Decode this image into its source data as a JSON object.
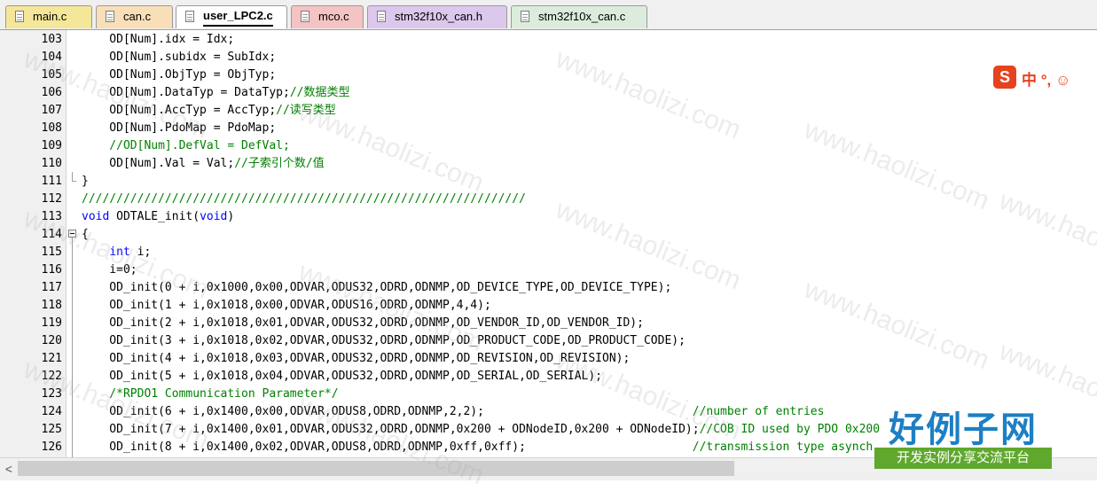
{
  "tabs": [
    {
      "label": "main.c",
      "color": "#f4e79a",
      "active": false
    },
    {
      "label": "can.c",
      "color": "#f8dfb8",
      "active": false
    },
    {
      "label": "user_LPC2.c",
      "color": "#ffffff",
      "active": true
    },
    {
      "label": "mco.c",
      "color": "#f4c3c3",
      "active": false
    },
    {
      "label": "stm32f10x_can.h",
      "color": "#dcc8ec",
      "active": false
    },
    {
      "label": "stm32f10x_can.c",
      "color": "#dcecdc",
      "active": false
    }
  ],
  "editor": {
    "line_numbers": [
      "103",
      "104",
      "105",
      "106",
      "107",
      "108",
      "109",
      "110",
      "111",
      "112",
      "113",
      "114",
      "115",
      "116",
      "117",
      "118",
      "119",
      "120",
      "121",
      "122",
      "123",
      "124",
      "125",
      "126"
    ],
    "lines": [
      [
        {
          "t": "    OD[Num].idx = Idx;",
          "c": "n"
        }
      ],
      [
        {
          "t": "    OD[Num].subidx = SubIdx;",
          "c": "n"
        }
      ],
      [
        {
          "t": "    OD[Num].ObjTyp = ObjTyp;",
          "c": "n"
        }
      ],
      [
        {
          "t": "    OD[Num].DataTyp = DataTyp;",
          "c": "n"
        },
        {
          "t": "//数据类型",
          "c": "c"
        }
      ],
      [
        {
          "t": "    OD[Num].AccTyp = AccTyp;",
          "c": "n"
        },
        {
          "t": "//读写类型",
          "c": "c"
        }
      ],
      [
        {
          "t": "    OD[Num].PdoMap = PdoMap;",
          "c": "n"
        }
      ],
      [
        {
          "t": "    //OD[Num].DefVal = DefVal;",
          "c": "c"
        }
      ],
      [
        {
          "t": "    OD[Num].Val = Val;",
          "c": "n"
        },
        {
          "t": "//子索引个数/值",
          "c": "c"
        }
      ],
      [
        {
          "t": "}",
          "c": "n"
        }
      ],
      [
        {
          "t": "////////////////////////////////////////////////////////////////",
          "c": "c"
        }
      ],
      [
        {
          "t": "void",
          "c": "k"
        },
        {
          "t": " ODTALE_init(",
          "c": "n"
        },
        {
          "t": "void",
          "c": "k"
        },
        {
          "t": ")",
          "c": "n"
        }
      ],
      [
        {
          "t": "{",
          "c": "n"
        }
      ],
      [
        {
          "t": "    ",
          "c": "n"
        },
        {
          "t": "int",
          "c": "k"
        },
        {
          "t": " i;",
          "c": "n"
        }
      ],
      [
        {
          "t": "    i=0;",
          "c": "n"
        }
      ],
      [
        {
          "t": "    OD_init(0 + i,0x1000,0x00,ODVAR,ODUS32,ODRD,ODNMP,OD_DEVICE_TYPE,OD_DEVICE_TYPE);",
          "c": "n"
        }
      ],
      [
        {
          "t": "    OD_init(1 + i,0x1018,0x00,ODVAR,ODUS16,ODRD,ODNMP,4,4);",
          "c": "n"
        }
      ],
      [
        {
          "t": "    OD_init(2 + i,0x1018,0x01,ODVAR,ODUS32,ODRD,ODNMP,OD_VENDOR_ID,OD_VENDOR_ID);",
          "c": "n"
        }
      ],
      [
        {
          "t": "    OD_init(3 + i,0x1018,0x02,ODVAR,ODUS32,ODRD,ODNMP,OD_PRODUCT_CODE,OD_PRODUCT_CODE);",
          "c": "n"
        }
      ],
      [
        {
          "t": "    OD_init(4 + i,0x1018,0x03,ODVAR,ODUS32,ODRD,ODNMP,OD_REVISION,OD_REVISION);",
          "c": "n"
        }
      ],
      [
        {
          "t": "    OD_init(5 + i,0x1018,0x04,ODVAR,ODUS32,ODRD,ODNMP,OD_SERIAL,OD_SERIAL);",
          "c": "n"
        }
      ],
      [
        {
          "t": "    /*RPDO1 Communication Parameter*/",
          "c": "c"
        }
      ],
      [
        {
          "t": "    OD_init(6 + i,0x1400,0x00,ODVAR,ODUS8,ODRD,ODNMP,2,2);                              ",
          "c": "n"
        },
        {
          "t": "//number of entries",
          "c": "c"
        }
      ],
      [
        {
          "t": "    OD_init(7 + i,0x1400,0x01,ODVAR,ODUS32,ODRD,ODNMP,0x200 + ODNodeID,0x200 + ODNodeID);",
          "c": "n"
        },
        {
          "t": "//COB ID used by PDO 0x200",
          "c": "c"
        }
      ],
      [
        {
          "t": "    OD_init(8 + i,0x1400,0x02,ODVAR,ODUS8,ODRD,ODNMP,0xff,0xff);                        ",
          "c": "n"
        },
        {
          "t": "//transmission type asynch",
          "c": "c"
        }
      ]
    ]
  },
  "ime": {
    "logo": "S",
    "text": "中 °, ☺"
  },
  "watermark": {
    "text": "www.haolizi.com"
  },
  "site_logo": {
    "title": "好例子网",
    "subtitle": "开发实例分享交流平台"
  },
  "scrollbar": {
    "left_arrow": "<"
  }
}
